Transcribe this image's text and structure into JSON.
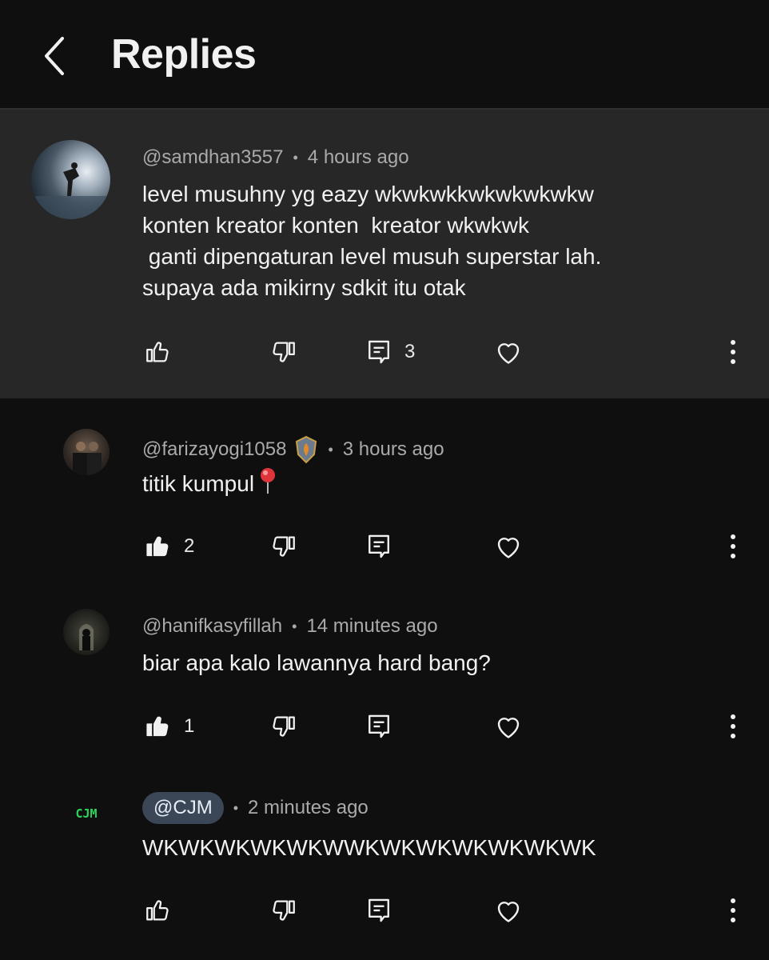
{
  "header": {
    "title": "Replies"
  },
  "comments": [
    {
      "handle": "@samdhan3557",
      "time": "4 hours ago",
      "lines": [
        "level musuhny yg eazy wkwkwkkwkwkwkwkw",
        "konten kreator konten  kreator wkwkwk",
        " ganti dipengaturan level musuh superstar lah.",
        "supaya ada mikirny sdkit itu otak"
      ],
      "reply_count": "3",
      "likes": ""
    },
    {
      "handle": "@farizayogi1058",
      "time": "3 hours ago",
      "text": "titik kumpul",
      "likes": "2"
    },
    {
      "handle": "@hanifkasyfillah",
      "time": "14 minutes ago",
      "text": "biar apa kalo lawannya hard bang?",
      "likes": "1"
    },
    {
      "handle": "@CJM",
      "time": "2 minutes ago",
      "text": "WKWKWKWKWKWWKWKWKWKWKWKWK",
      "avatar_text": "CJM",
      "likes": ""
    }
  ],
  "colors": {
    "background": "#0f0f0f",
    "highlight": "#272727",
    "meta_text": "#aaaaaa",
    "pill": "#3b4656",
    "cjm_green": "#2fd35a"
  }
}
